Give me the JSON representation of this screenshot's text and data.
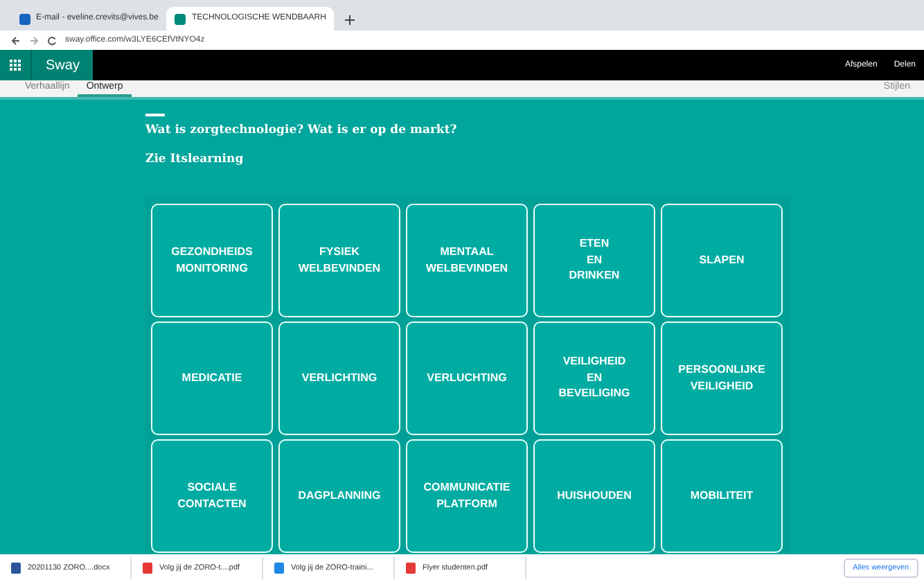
{
  "browser": {
    "tabs": [
      {
        "label": "E-mail - eveline.crevits@vives.be",
        "selected": false
      },
      {
        "label": "TECHNOLOGISCHE WENDBAARH",
        "selected": true
      }
    ],
    "url": "sway.office.com/w3LYE6CEfVtNYO4z"
  },
  "app_bar": {
    "title": "Sway",
    "actions": [
      "Afspelen",
      "Delen"
    ]
  },
  "mode_tabs": [
    {
      "label": "Verhaallijn",
      "selected": false
    },
    {
      "label": "Ontwerp",
      "selected": true
    }
  ],
  "toolbar": {
    "styles": "Stijlen"
  },
  "heading": "Wat is zorgtechnologie? Wat is er op de markt?",
  "subtext": "Zie Itslearning",
  "tiles": [
    [
      "GEZONDHEIDS",
      "MONITORING"
    ],
    [
      "FYSIEK",
      "WELBEVINDEN"
    ],
    [
      "MENTAAL",
      "WELBEVINDEN"
    ],
    [
      "ETEN",
      "EN",
      "DRINKEN"
    ],
    [
      "SLAPEN"
    ],
    [
      "MEDICATIE"
    ],
    [
      "VERLICHTING"
    ],
    [
      "VERLUCHTING"
    ],
    [
      "VEILIGHEID",
      "EN",
      "BEVEILIGING"
    ],
    [
      "PERSOONLIJKE",
      "VEILIGHEID"
    ],
    [
      "SOCIALE",
      "CONTACTEN"
    ],
    [
      "DAGPLANNING"
    ],
    [
      "COMMUNICATIE",
      "PLATFORM"
    ],
    [
      "HUISHOUDEN"
    ],
    [
      "MOBILITEIT"
    ]
  ],
  "downloads": [
    {
      "name": "20201130 ZORO....docx",
      "kind": "doc"
    },
    {
      "name": "Volg jij de ZORO-t....pdf",
      "kind": "pdf"
    },
    {
      "name": "Volg jij de ZORO-traini...",
      "kind": "img"
    },
    {
      "name": "Flyer studenten.pdf",
      "kind": "pdf"
    }
  ],
  "show_all": "Alles weergeven"
}
